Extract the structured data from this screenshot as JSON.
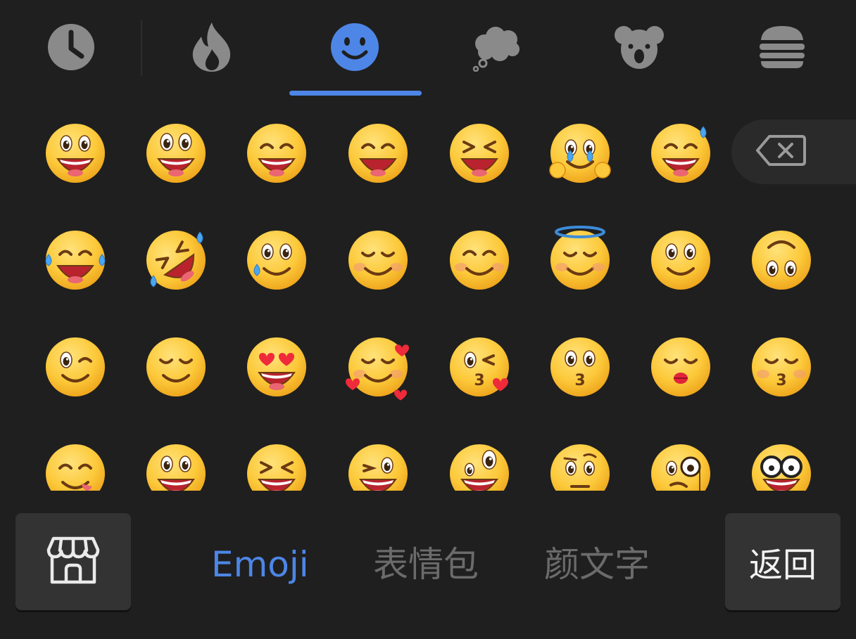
{
  "colors": {
    "background": "#1f1f1f",
    "accent": "#4d86e6",
    "inactive_icon": "#8a8a8a",
    "inactive_tab": "#6b6b6b",
    "button_bg": "#333333"
  },
  "categories": [
    {
      "icon": "clock-icon",
      "label": "recent",
      "active": false
    },
    {
      "icon": "fire-icon",
      "label": "popular",
      "active": false
    },
    {
      "icon": "smiley-icon",
      "label": "emoji",
      "active": true
    },
    {
      "icon": "thought-bubble-icon",
      "label": "bubbles",
      "active": false
    },
    {
      "icon": "koala-icon",
      "label": "animals",
      "active": false
    },
    {
      "icon": "burger-icon",
      "label": "food",
      "active": false
    }
  ],
  "emojis": [
    [
      "grinning-big-eyes",
      "grinning-wide",
      "grinning-squint-eyes",
      "grinning-smiling-eyes",
      "laughing-squint",
      "holding-back-tears",
      "grinning-sweat"
    ],
    [
      "tears-of-joy",
      "rolling-on-floor-laughing",
      "smiling-tear",
      "smiling-blush",
      "smiling-eyes",
      "halo",
      "slightly-smiling",
      "upside-down"
    ],
    [
      "winking",
      "relieved",
      "heart-eyes",
      "smiling-hearts",
      "kissing-heart",
      "kissing",
      "kiss-lips",
      "kissing-closed-eyes"
    ],
    [
      "yum",
      "grinning-tongue",
      "squinting-tongue",
      "winking-tongue",
      "zany",
      "raised-eyebrow",
      "monocle",
      "nerd"
    ]
  ],
  "backspace": {
    "icon": "backspace-icon"
  },
  "bottom": {
    "store_icon": "store-icon",
    "tabs": [
      {
        "label": "Emoji",
        "active": true
      },
      {
        "label": "表情包",
        "active": false
      },
      {
        "label": "颜文字",
        "active": false
      }
    ],
    "back_label": "返回"
  }
}
